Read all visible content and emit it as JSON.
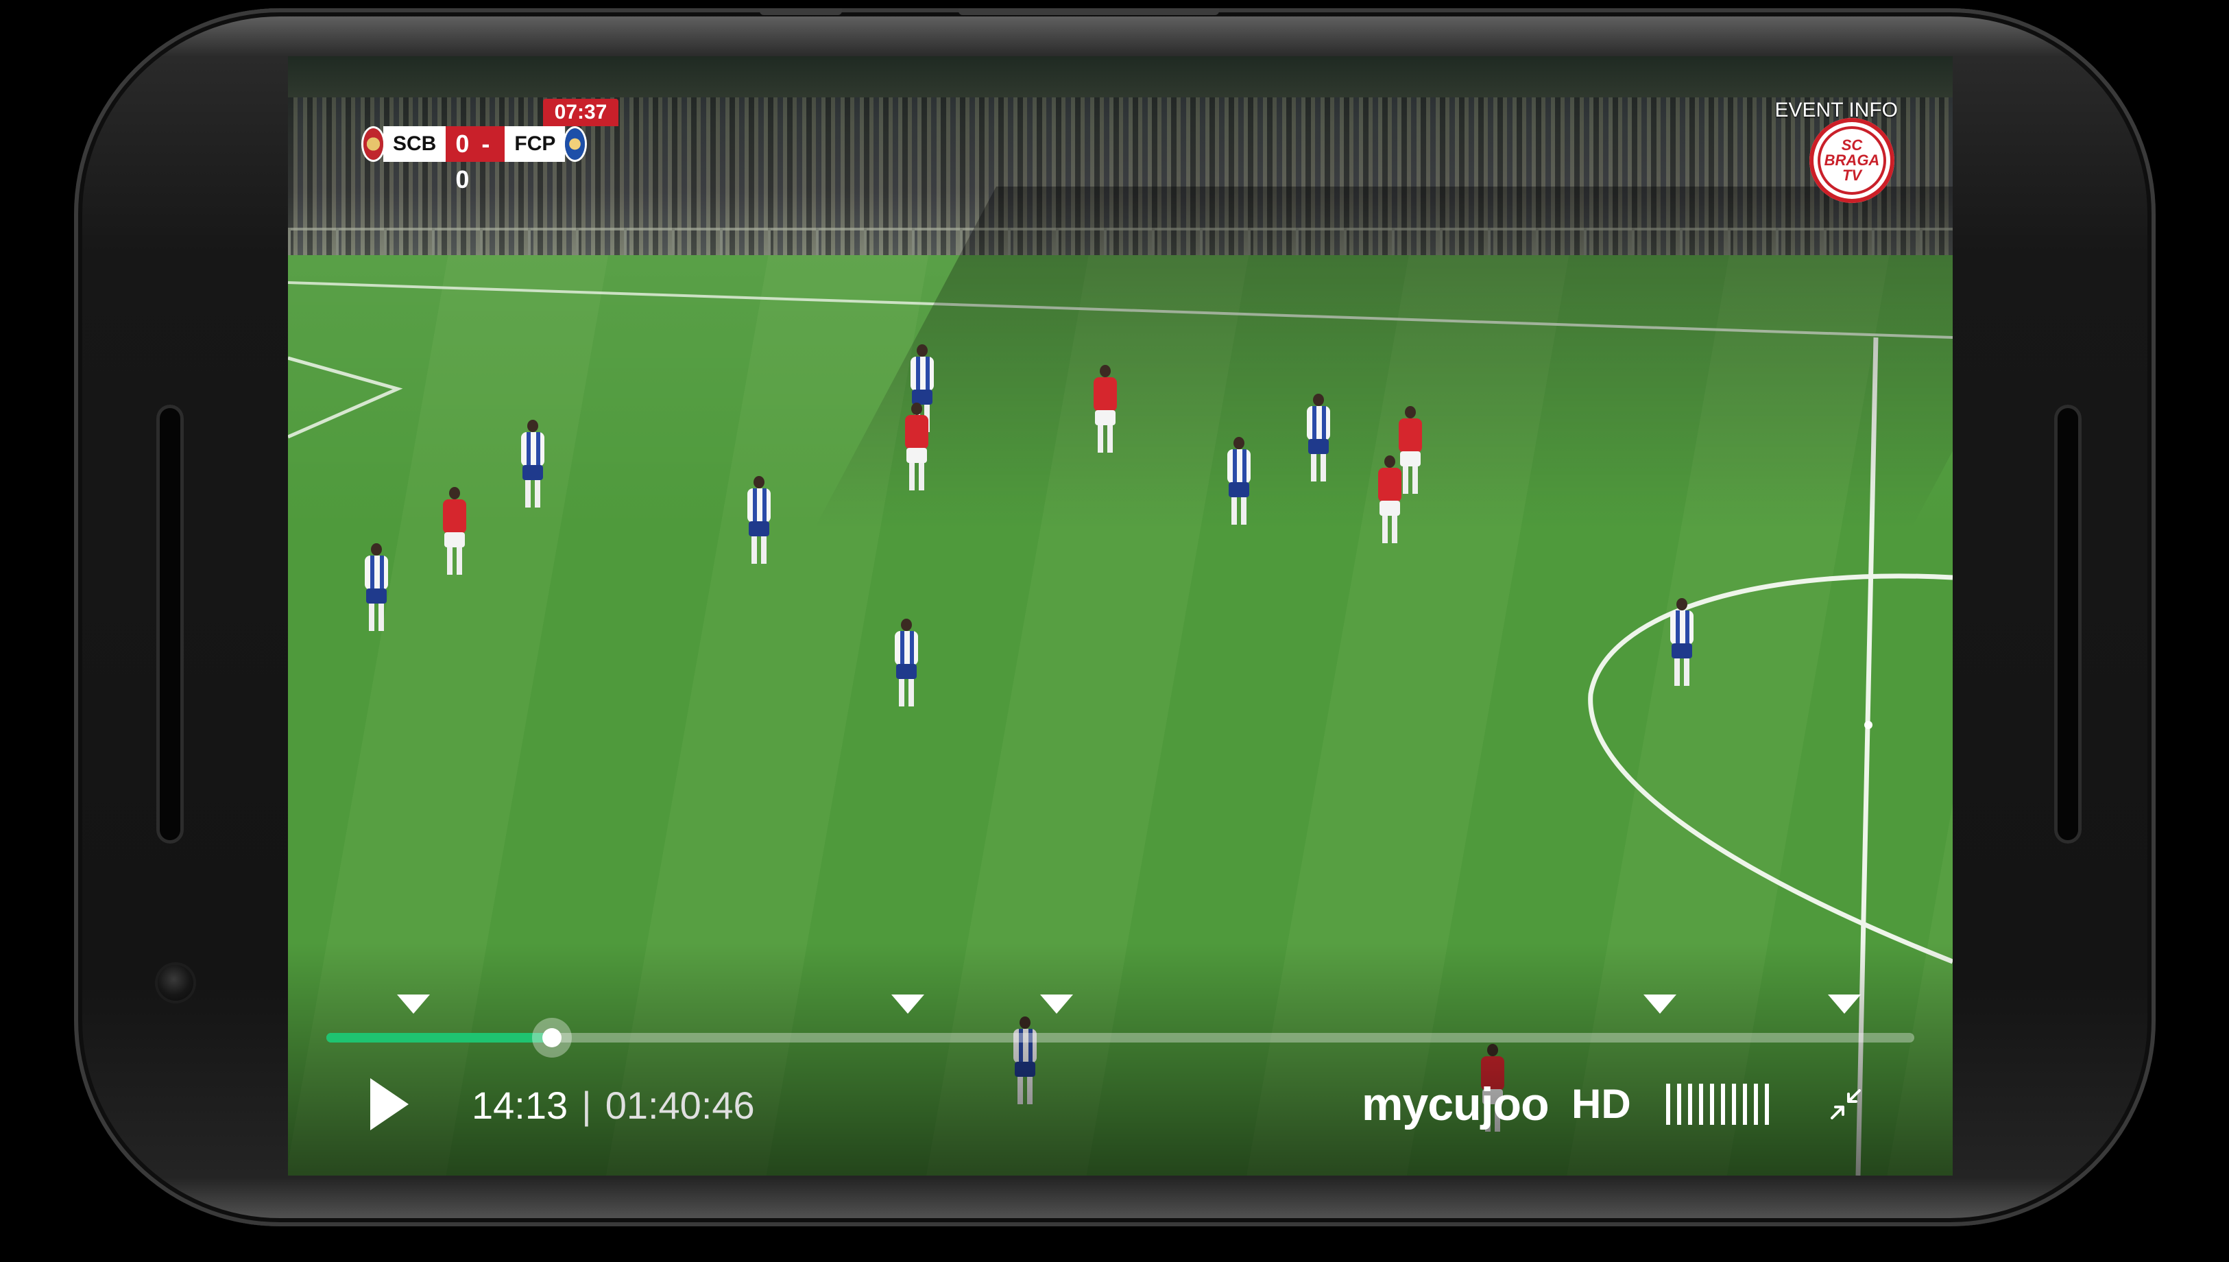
{
  "scoreboard": {
    "clock": "07:37",
    "home_team": "SCB",
    "score": "0 - 0",
    "away_team": "FCP"
  },
  "event_info_label": "EVENT INFO",
  "channel_logo": {
    "line1": "SC BRAGA",
    "line2": "TV"
  },
  "player": {
    "current_time": "14:13",
    "separator": "|",
    "total_time": "01:40:46",
    "progress_fraction": 0.142,
    "accent_color": "#1fc471",
    "marker_fractions": [
      0.055,
      0.366,
      0.46,
      0.84,
      0.956
    ],
    "play_icon": "play-icon",
    "brand": "mycujoo",
    "quality_label": "HD",
    "bitrate_icon": "bars-icon",
    "fullscreen_icon": "exit-fullscreen-icon"
  },
  "colors": {
    "home_red": "#c9202a",
    "away_blue": "#1f3a8c",
    "pitch_green": "#4f9a3c"
  }
}
